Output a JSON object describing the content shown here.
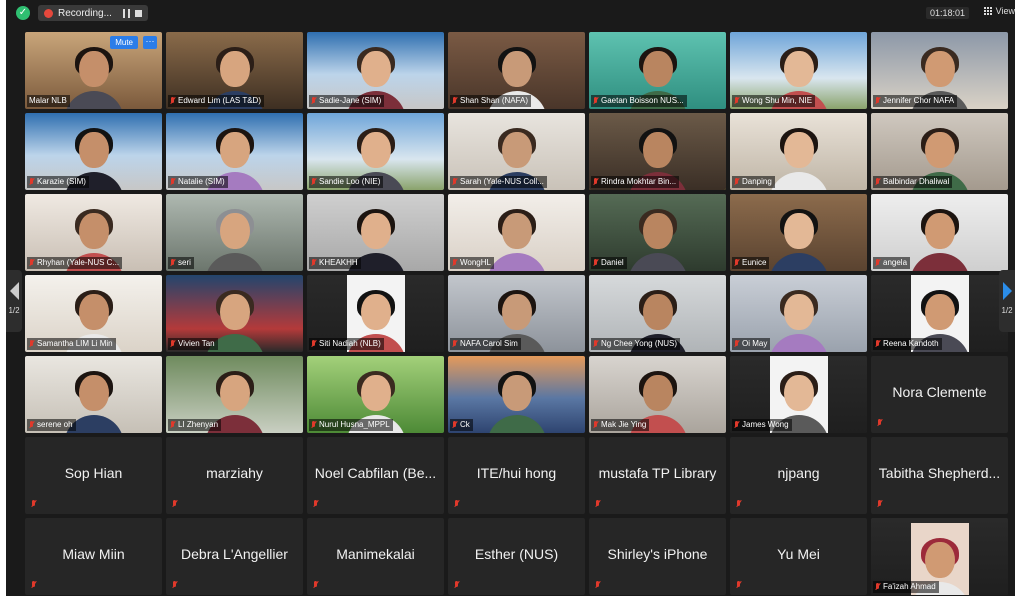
{
  "topbar": {
    "recording_label": "Recording...",
    "timer": "01:18:01",
    "view_label": "View"
  },
  "controls": {
    "mute_label": "Mute",
    "more_label": "···"
  },
  "pager": {
    "left": "1/2",
    "right": "1/2"
  },
  "participants": [
    {
      "name": "Malar NLB"
    },
    {
      "name": "Edward Lim (LAS T&D)"
    },
    {
      "name": "Sadie-Jane (SIM)"
    },
    {
      "name": "Shan Shan (NAFA)"
    },
    {
      "name": "Gaetan Boisson NUS..."
    },
    {
      "name": "Wong Shu Min, NIE"
    },
    {
      "name": "Jennifer Chor NAFA"
    },
    {
      "name": "Karazie (SIM)"
    },
    {
      "name": "Natalie (SIM)"
    },
    {
      "name": "Sandie Loo (NIE)"
    },
    {
      "name": "Sarah (Yale-NUS Coll..."
    },
    {
      "name": "Rindra Mokhtar Bin..."
    },
    {
      "name": "Danping"
    },
    {
      "name": "Balbindar Dhaliwal"
    },
    {
      "name": "Rhyhan (Yale-NUS C..."
    },
    {
      "name": "seri"
    },
    {
      "name": "KHEAKHH"
    },
    {
      "name": "WongHL"
    },
    {
      "name": "Daniel"
    },
    {
      "name": "Eunice"
    },
    {
      "name": "angela"
    },
    {
      "name": "Samantha LIM Li Min"
    },
    {
      "name": "Vivien Tan"
    },
    {
      "name": "Siti Nadiah (NLB)"
    },
    {
      "name": "NAFA Carol Sim"
    },
    {
      "name": "Ng Chee Yong (NUS)"
    },
    {
      "name": "Oi May"
    },
    {
      "name": "Reena Kandoth"
    },
    {
      "name": "serene oh"
    },
    {
      "name": "LI Zhenyan"
    },
    {
      "name": "Nurul Husna_MPPL"
    },
    {
      "name": "Ck"
    },
    {
      "name": "Mak Jie Ying"
    },
    {
      "name": "James Wong"
    },
    {
      "name": "Nora Clemente"
    },
    {
      "name": "Sop Hian"
    },
    {
      "name": "marziahy"
    },
    {
      "name": "Noel Cabfilan (Be..."
    },
    {
      "name": "ITE/hui hong"
    },
    {
      "name": "mustafa TP Library"
    },
    {
      "name": "njpang"
    },
    {
      "name": "Tabitha Shepherd..."
    },
    {
      "name": "Miaw Miin"
    },
    {
      "name": "Debra L'Angellier"
    },
    {
      "name": "Manimekalai"
    },
    {
      "name": "Esther (NUS)"
    },
    {
      "name": "Shirley's iPhone"
    },
    {
      "name": "Yu Mei"
    },
    {
      "name": "Fa'izah Ahmad"
    }
  ],
  "colors": {
    "accent": "#2b7de9",
    "muted_mic": "#e0392b",
    "active_speaker": "#d6d33c",
    "tile_bg": "#262626"
  }
}
